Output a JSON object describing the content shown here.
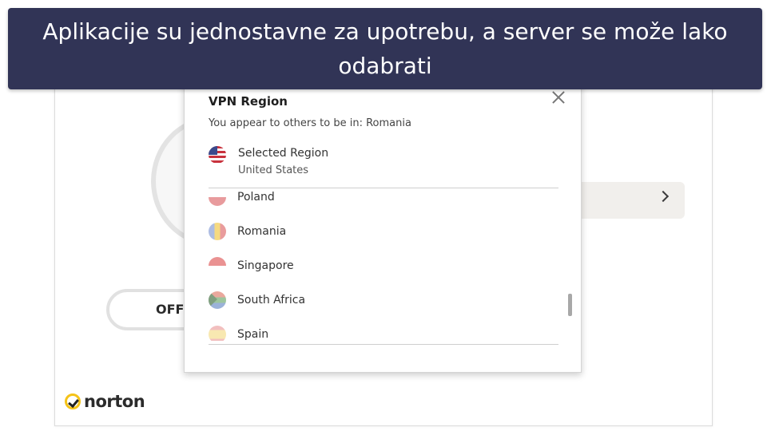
{
  "banner": {
    "text": "Aplikacije su jednostavne za upotrebu, a server se može lako odabrati",
    "bg_color": "#313456"
  },
  "app": {
    "toggle_label": "OFF",
    "brand": "norton",
    "brand_color": "#f5c318"
  },
  "popup": {
    "title": "VPN Region",
    "appear_prefix": "You appear to others to be in: ",
    "appear_country": "Romania",
    "selected_label": "Selected Region",
    "selected_value": "United States",
    "items": [
      {
        "label": "Poland",
        "flag": "poland-flag-icon"
      },
      {
        "label": "Romania",
        "flag": "romania-flag-icon"
      },
      {
        "label": "Singapore",
        "flag": "singapore-flag-icon"
      },
      {
        "label": "South Africa",
        "flag": "south-africa-flag-icon"
      },
      {
        "label": "Spain",
        "flag": "spain-flag-icon"
      }
    ]
  }
}
